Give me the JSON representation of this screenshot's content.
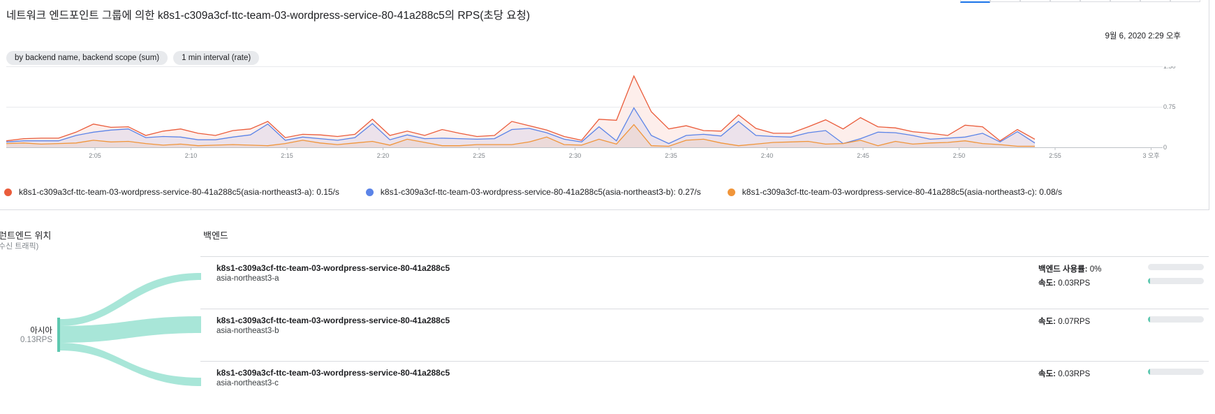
{
  "title": "네트워크 엔드포인트 그룹에 의한 k8s1-c309a3cf-ttc-team-03-wordpress-service-80-41a288c5의 RPS(초당 요청)",
  "timestamp": "9월 6, 2020 2:29 오후",
  "chips": [
    "by backend name, backend scope (sum)",
    "1 min interval (rate)"
  ],
  "colors": {
    "red": "#ea5c3b",
    "blue": "#5b84e8",
    "orange": "#f0953a",
    "teal": "#a8e6d8",
    "teal_dark": "#5ec8b0"
  },
  "chart_data": {
    "type": "area",
    "xlabels": [
      "2:05",
      "2:10",
      "2:15",
      "2:20",
      "2:25",
      "2:30",
      "2:35",
      "2:40",
      "2:45",
      "2:50",
      "2:55",
      "3 오후"
    ],
    "ylabels": [
      "1.50",
      "0.75",
      "0"
    ],
    "ylim": [
      0,
      1.5
    ],
    "grid": true,
    "legend_position": "bottom",
    "series": [
      {
        "name": "k8s1-c309a3cf-ttc-team-03-wordpress-service-80-41a288c5(asia-northeast3-a): 0.15/s",
        "color": "#ea5c3b",
        "values": [
          0.12,
          0.16,
          0.17,
          0.17,
          0.28,
          0.43,
          0.37,
          0.38,
          0.22,
          0.3,
          0.34,
          0.26,
          0.22,
          0.31,
          0.34,
          0.48,
          0.18,
          0.24,
          0.23,
          0.2,
          0.24,
          0.52,
          0.22,
          0.3,
          0.22,
          0.33,
          0.26,
          0.2,
          0.22,
          0.48,
          0.4,
          0.32,
          0.2,
          0.13,
          0.52,
          0.5,
          1.32,
          0.66,
          0.34,
          0.4,
          0.31,
          0.3,
          0.6,
          0.35,
          0.26,
          0.26,
          0.38,
          0.51,
          0.34,
          0.55,
          0.38,
          0.36,
          0.29,
          0.26,
          0.22,
          0.41,
          0.38,
          0.12,
          0.33,
          0.15
        ]
      },
      {
        "name": "k8s1-c309a3cf-ttc-team-03-wordpress-service-80-41a288c5(asia-northeast3-b): 0.27/s",
        "color": "#5b84e8",
        "values": [
          0.1,
          0.12,
          0.12,
          0.12,
          0.22,
          0.28,
          0.32,
          0.34,
          0.18,
          0.2,
          0.19,
          0.14,
          0.14,
          0.19,
          0.23,
          0.43,
          0.13,
          0.19,
          0.16,
          0.13,
          0.18,
          0.44,
          0.14,
          0.23,
          0.16,
          0.17,
          0.16,
          0.15,
          0.16,
          0.33,
          0.35,
          0.27,
          0.15,
          0.1,
          0.38,
          0.12,
          0.73,
          0.22,
          0.07,
          0.22,
          0.24,
          0.21,
          0.48,
          0.22,
          0.2,
          0.19,
          0.27,
          0.31,
          0.07,
          0.16,
          0.28,
          0.27,
          0.22,
          0.15,
          0.17,
          0.19,
          0.26,
          0.1,
          0.29,
          0.08
        ]
      },
      {
        "name": "k8s1-c309a3cf-ttc-team-03-wordpress-service-80-41a288c5(asia-northeast3-c): 0.08/s",
        "color": "#f0953a",
        "values": [
          0.07,
          0.08,
          0.06,
          0.07,
          0.08,
          0.13,
          0.1,
          0.11,
          0.07,
          0.04,
          0.06,
          0.03,
          0.04,
          0.05,
          0.04,
          0.03,
          0.07,
          0.13,
          0.08,
          0.05,
          0.08,
          0.11,
          0.04,
          0.15,
          0.09,
          0.03,
          0.03,
          0.05,
          0.05,
          0.05,
          0.1,
          0.19,
          0.05,
          0.04,
          0.15,
          0.06,
          0.42,
          0.03,
          0.02,
          0.13,
          0.15,
          0.08,
          0.03,
          0.06,
          0.09,
          0.1,
          0.11,
          0.06,
          0.07,
          0.13,
          0.03,
          0.11,
          0.06,
          0.08,
          0.09,
          0.12,
          0.07,
          0.05,
          0.02,
          0.02
        ]
      }
    ]
  },
  "frontend": {
    "title": "런트엔드 위치",
    "subtitle": "수신 트래픽)",
    "region": "아시아",
    "rps": "0.13RPS"
  },
  "backend": {
    "title": "백엔드",
    "rows": [
      {
        "name": "k8s1-c309a3cf-ttc-team-03-wordpress-service-80-41a288c5",
        "zone": "asia-northeast3-a",
        "usage_label": "백엔드 사용률:",
        "usage_value": "0%",
        "usage_fraction": 0,
        "rate_label": "속도:",
        "rate_value": "0.03RPS",
        "rate_fraction": 0.03
      },
      {
        "name": "k8s1-c309a3cf-ttc-team-03-wordpress-service-80-41a288c5",
        "zone": "asia-northeast3-b",
        "rate_label": "속도:",
        "rate_value": "0.07RPS",
        "rate_fraction": 0.03
      },
      {
        "name": "k8s1-c309a3cf-ttc-team-03-wordpress-service-80-41a288c5",
        "zone": "asia-northeast3-c",
        "rate_label": "속도:",
        "rate_value": "0.03RPS",
        "rate_fraction": 0.03
      }
    ]
  }
}
